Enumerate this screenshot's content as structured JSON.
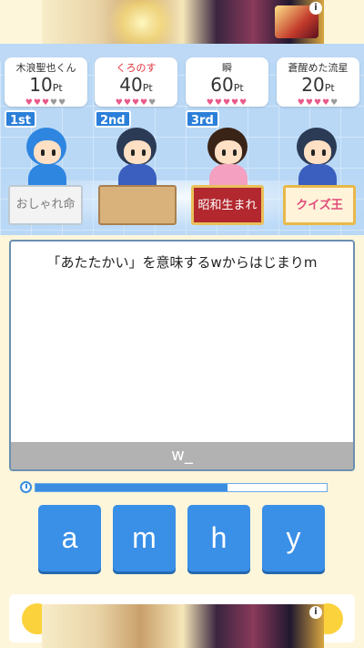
{
  "players": [
    {
      "name": "木浪聖也くん",
      "points": "10",
      "unit": "Pt",
      "hearts": [
        1,
        1,
        1,
        0,
        0
      ],
      "highlight": false
    },
    {
      "name": "くろのす",
      "points": "40",
      "unit": "Pt",
      "hearts": [
        1,
        1,
        1,
        1,
        0
      ],
      "highlight": true
    },
    {
      "name": "瞬",
      "points": "60",
      "unit": "Pt",
      "hearts": [
        1,
        1,
        1,
        1,
        1
      ],
      "highlight": false
    },
    {
      "name": "蒼醒めた流星",
      "points": "20",
      "unit": "Pt",
      "hearts": [
        1,
        1,
        1,
        1,
        0
      ],
      "highlight": false
    }
  ],
  "ranks": [
    "1st",
    "2nd",
    "3rd"
  ],
  "signs": [
    "おしゃれ命",
    "",
    "昭和生まれ",
    "クイズ王"
  ],
  "question": "「あたたかい」を意味するwからはじまりm",
  "answer": "w_",
  "timer_progress": 0.66,
  "keys": [
    "a",
    "m",
    "h",
    "y"
  ],
  "ad_info": "i",
  "colors": {
    "accent": "#3a8fe7",
    "heart_on": "#e85a8a",
    "heart_off": "#9a9a9a",
    "highlight_name": "#e0303a"
  }
}
